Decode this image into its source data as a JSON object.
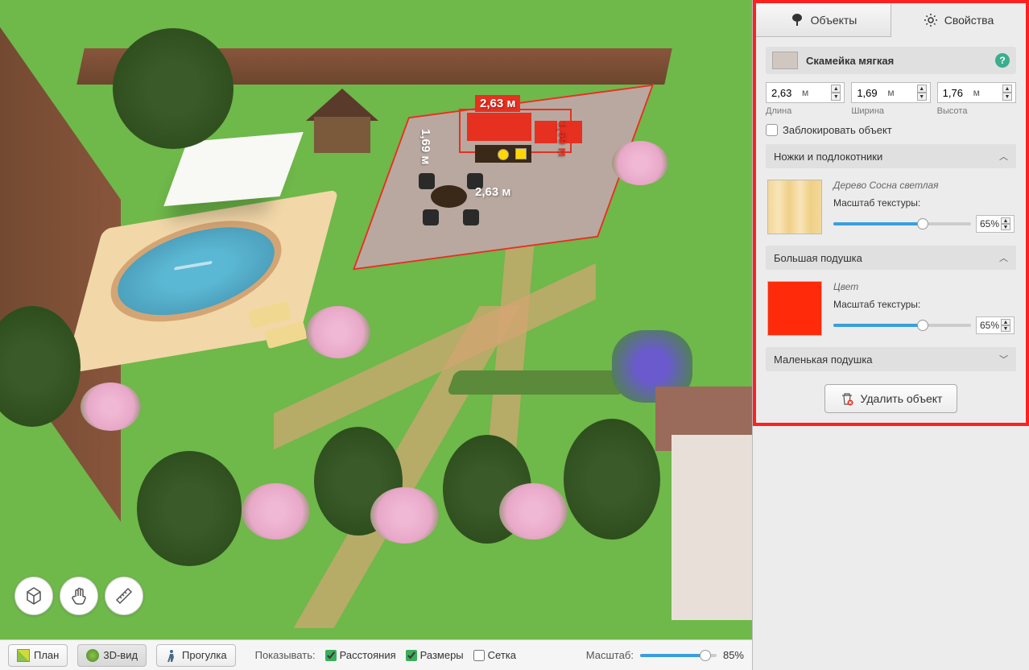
{
  "viewport": {
    "dimensions": {
      "width": "2,63 м",
      "height": "1,69 м",
      "width_bottom": "2,63 м",
      "height_right": "1,69 м"
    }
  },
  "bottom_bar": {
    "modes": {
      "plan": "План",
      "view3d": "3D-вид",
      "walk": "Прогулка"
    },
    "show_label": "Показывать:",
    "distances": "Расстояния",
    "sizes": "Размеры",
    "grid": "Сетка",
    "scale_label": "Масштаб:",
    "scale_value": "85%",
    "scale_percent": 85
  },
  "sidebar": {
    "tabs": {
      "objects": "Объекты",
      "properties": "Свойства"
    },
    "object_name": "Скамейка мягкая",
    "dims": {
      "length": {
        "value": "2,63",
        "unit": "м",
        "label": "Длина"
      },
      "width": {
        "value": "1,69",
        "unit": "м",
        "label": "Ширина"
      },
      "height": {
        "value": "1,76",
        "unit": "м",
        "label": "Высота"
      }
    },
    "lock_label": "Заблокировать объект",
    "sections": {
      "legs": {
        "title": "Ножки и подлокотники",
        "material": "Дерево Сосна светлая",
        "texture_label": "Масштаб текстуры:",
        "texture_value": "65%",
        "texture_percent": 65
      },
      "big_pillow": {
        "title": "Большая подушка",
        "material": "Цвет",
        "texture_label": "Масштаб текстуры:",
        "texture_value": "65%",
        "texture_percent": 65
      },
      "small_pillow": {
        "title": "Маленькая подушка"
      }
    },
    "delete_label": "Удалить объект"
  }
}
